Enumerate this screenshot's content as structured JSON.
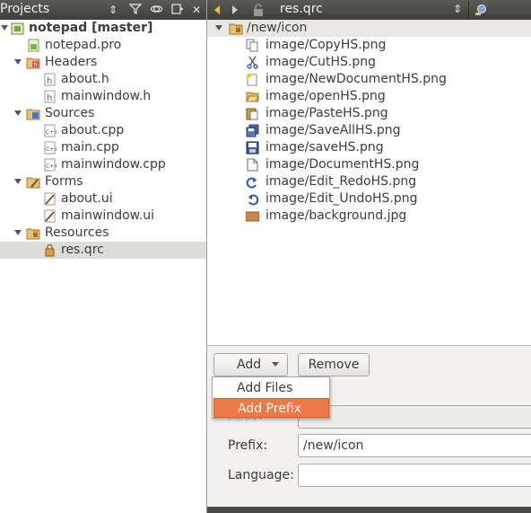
{
  "projects_panel": {
    "title": "Projects",
    "tree": [
      {
        "label": "notepad [master]",
        "level": 0,
        "icon": "project-icon",
        "expanded": true
      },
      {
        "label": "notepad.pro",
        "level": 1,
        "icon": "pro-file-icon"
      },
      {
        "label": "Headers",
        "level": 1,
        "icon": "headers-folder-icon",
        "expanded": true
      },
      {
        "label": "about.h",
        "level": 2,
        "icon": "header-file-icon"
      },
      {
        "label": "mainwindow.h",
        "level": 2,
        "icon": "header-file-icon"
      },
      {
        "label": "Sources",
        "level": 1,
        "icon": "sources-folder-icon",
        "expanded": true
      },
      {
        "label": "about.cpp",
        "level": 2,
        "icon": "cpp-file-icon"
      },
      {
        "label": "main.cpp",
        "level": 2,
        "icon": "cpp-file-icon"
      },
      {
        "label": "mainwindow.cpp",
        "level": 2,
        "icon": "cpp-file-icon"
      },
      {
        "label": "Forms",
        "level": 1,
        "icon": "forms-folder-icon",
        "expanded": true
      },
      {
        "label": "about.ui",
        "level": 2,
        "icon": "ui-file-icon"
      },
      {
        "label": "mainwindow.ui",
        "level": 2,
        "icon": "ui-file-icon"
      },
      {
        "label": "Resources",
        "level": 1,
        "icon": "resources-folder-icon",
        "expanded": true
      },
      {
        "label": "res.qrc",
        "level": 2,
        "icon": "qrc-file-icon",
        "selected": true
      }
    ]
  },
  "editor_header": {
    "file_name": "res.qrc"
  },
  "resources": {
    "prefix": "/new/icon",
    "files": [
      {
        "label": "image/CopyHS.png",
        "icon": "copy-icon"
      },
      {
        "label": "image/CutHS.png",
        "icon": "scissors-icon"
      },
      {
        "label": "image/NewDocumentHS.png",
        "icon": "new-document-icon"
      },
      {
        "label": "image/openHS.png",
        "icon": "open-folder-icon"
      },
      {
        "label": "image/PasteHS.png",
        "icon": "paste-icon"
      },
      {
        "label": "image/SaveAllHS.png",
        "icon": "save-all-icon"
      },
      {
        "label": "image/saveHS.png",
        "icon": "save-icon"
      },
      {
        "label": "image/DocumentHS.png",
        "icon": "document-icon"
      },
      {
        "label": "image/Edit_RedoHS.png",
        "icon": "redo-icon"
      },
      {
        "label": "image/Edit_UndoHS.png",
        "icon": "undo-icon"
      },
      {
        "label": "image/background.jpg",
        "icon": "image-thumbnail-icon"
      }
    ]
  },
  "editor": {
    "add_label": "Add",
    "remove_label": "Remove",
    "alias_label": "Alias:",
    "alias_value": "",
    "prefix_label": "Prefix:",
    "prefix_value": "/new/icon",
    "language_label": "Language:",
    "language_value": ""
  },
  "add_menu": {
    "items": [
      {
        "label": "Add Files",
        "active": false
      },
      {
        "label": "Add Prefix",
        "active": true
      }
    ]
  },
  "colors": {
    "header_bg": "#4c4c48",
    "menu_highlight": "#f07746",
    "selected_row": "#dcdcd9"
  }
}
